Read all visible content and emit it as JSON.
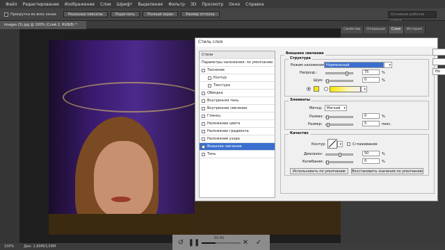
{
  "menu": [
    "Файл",
    "Редактирование",
    "Изображение",
    "Слои",
    "Шрифт",
    "Выделение",
    "Фильтр",
    "3D",
    "Просмотр",
    "Окно",
    "Справка"
  ],
  "options": {
    "scroll_all": "Прокрутка во всех окнах",
    "buttons": [
      "Реальные пикселы",
      "Подогнать",
      "Полный экран",
      "Размер оттиска"
    ],
    "workspace": "Основная рабочая среда"
  },
  "document_tab": "images (5).jpg @ 100% (Слой 2, RGB/8) *",
  "panel_tabs": [
    "Свойства",
    "Операции",
    "Слои",
    "История"
  ],
  "status": {
    "zoom": "100%",
    "doc": "Док: 1,60M/3,59M"
  },
  "player": {
    "time": "02:41",
    "progress": 0.35
  },
  "dialog": {
    "title": "Стиль слоя",
    "styles_header": "Стили",
    "blend_default": "Параметры наложения: по умолчанию",
    "items": [
      {
        "label": "Тиснение",
        "checked": false,
        "indent": false
      },
      {
        "label": "Контур",
        "checked": false,
        "indent": true
      },
      {
        "label": "Текстура",
        "checked": false,
        "indent": true
      },
      {
        "label": "Обводка",
        "checked": false,
        "indent": false
      },
      {
        "label": "Внутренняя тень",
        "checked": false,
        "indent": false
      },
      {
        "label": "Внутреннее свечение",
        "checked": false,
        "indent": false
      },
      {
        "label": "Глянец",
        "checked": false,
        "indent": false
      },
      {
        "label": "Наложение цвета",
        "checked": false,
        "indent": false
      },
      {
        "label": "Наложение градиента",
        "checked": false,
        "indent": false
      },
      {
        "label": "Наложение узора",
        "checked": false,
        "indent": false
      },
      {
        "label": "Внешнее свечение",
        "checked": true,
        "indent": false,
        "selected": true
      },
      {
        "label": "Тень",
        "checked": false,
        "indent": false
      }
    ],
    "outer_glow": "Внешнее свечение",
    "structure": "Структура",
    "blend_mode_label": "Режим наложения:",
    "blend_mode_value": "Нормальный",
    "opacity_label": "Непрозр.:",
    "opacity_value": "75",
    "noise_label": "Шум:",
    "noise_value": "0",
    "percent": "%",
    "elements": "Элементы",
    "method_label": "Метод:",
    "method_value": "Мягкий",
    "spread_label": "Размах:",
    "spread_value": "0",
    "size_label": "Размер:",
    "size_value": "5",
    "px": "пикс.",
    "quality": "Качество",
    "contour_label": "Контур:",
    "antialias": "Сглаживание",
    "range_label": "Диапазон:",
    "range_value": "50",
    "jitter_label": "Колебание:",
    "jitter_value": "0",
    "make_default": "Использовать по умолчанию",
    "reset_default": "Восстановить значения по умолчанию",
    "right_btn": "Но"
  }
}
